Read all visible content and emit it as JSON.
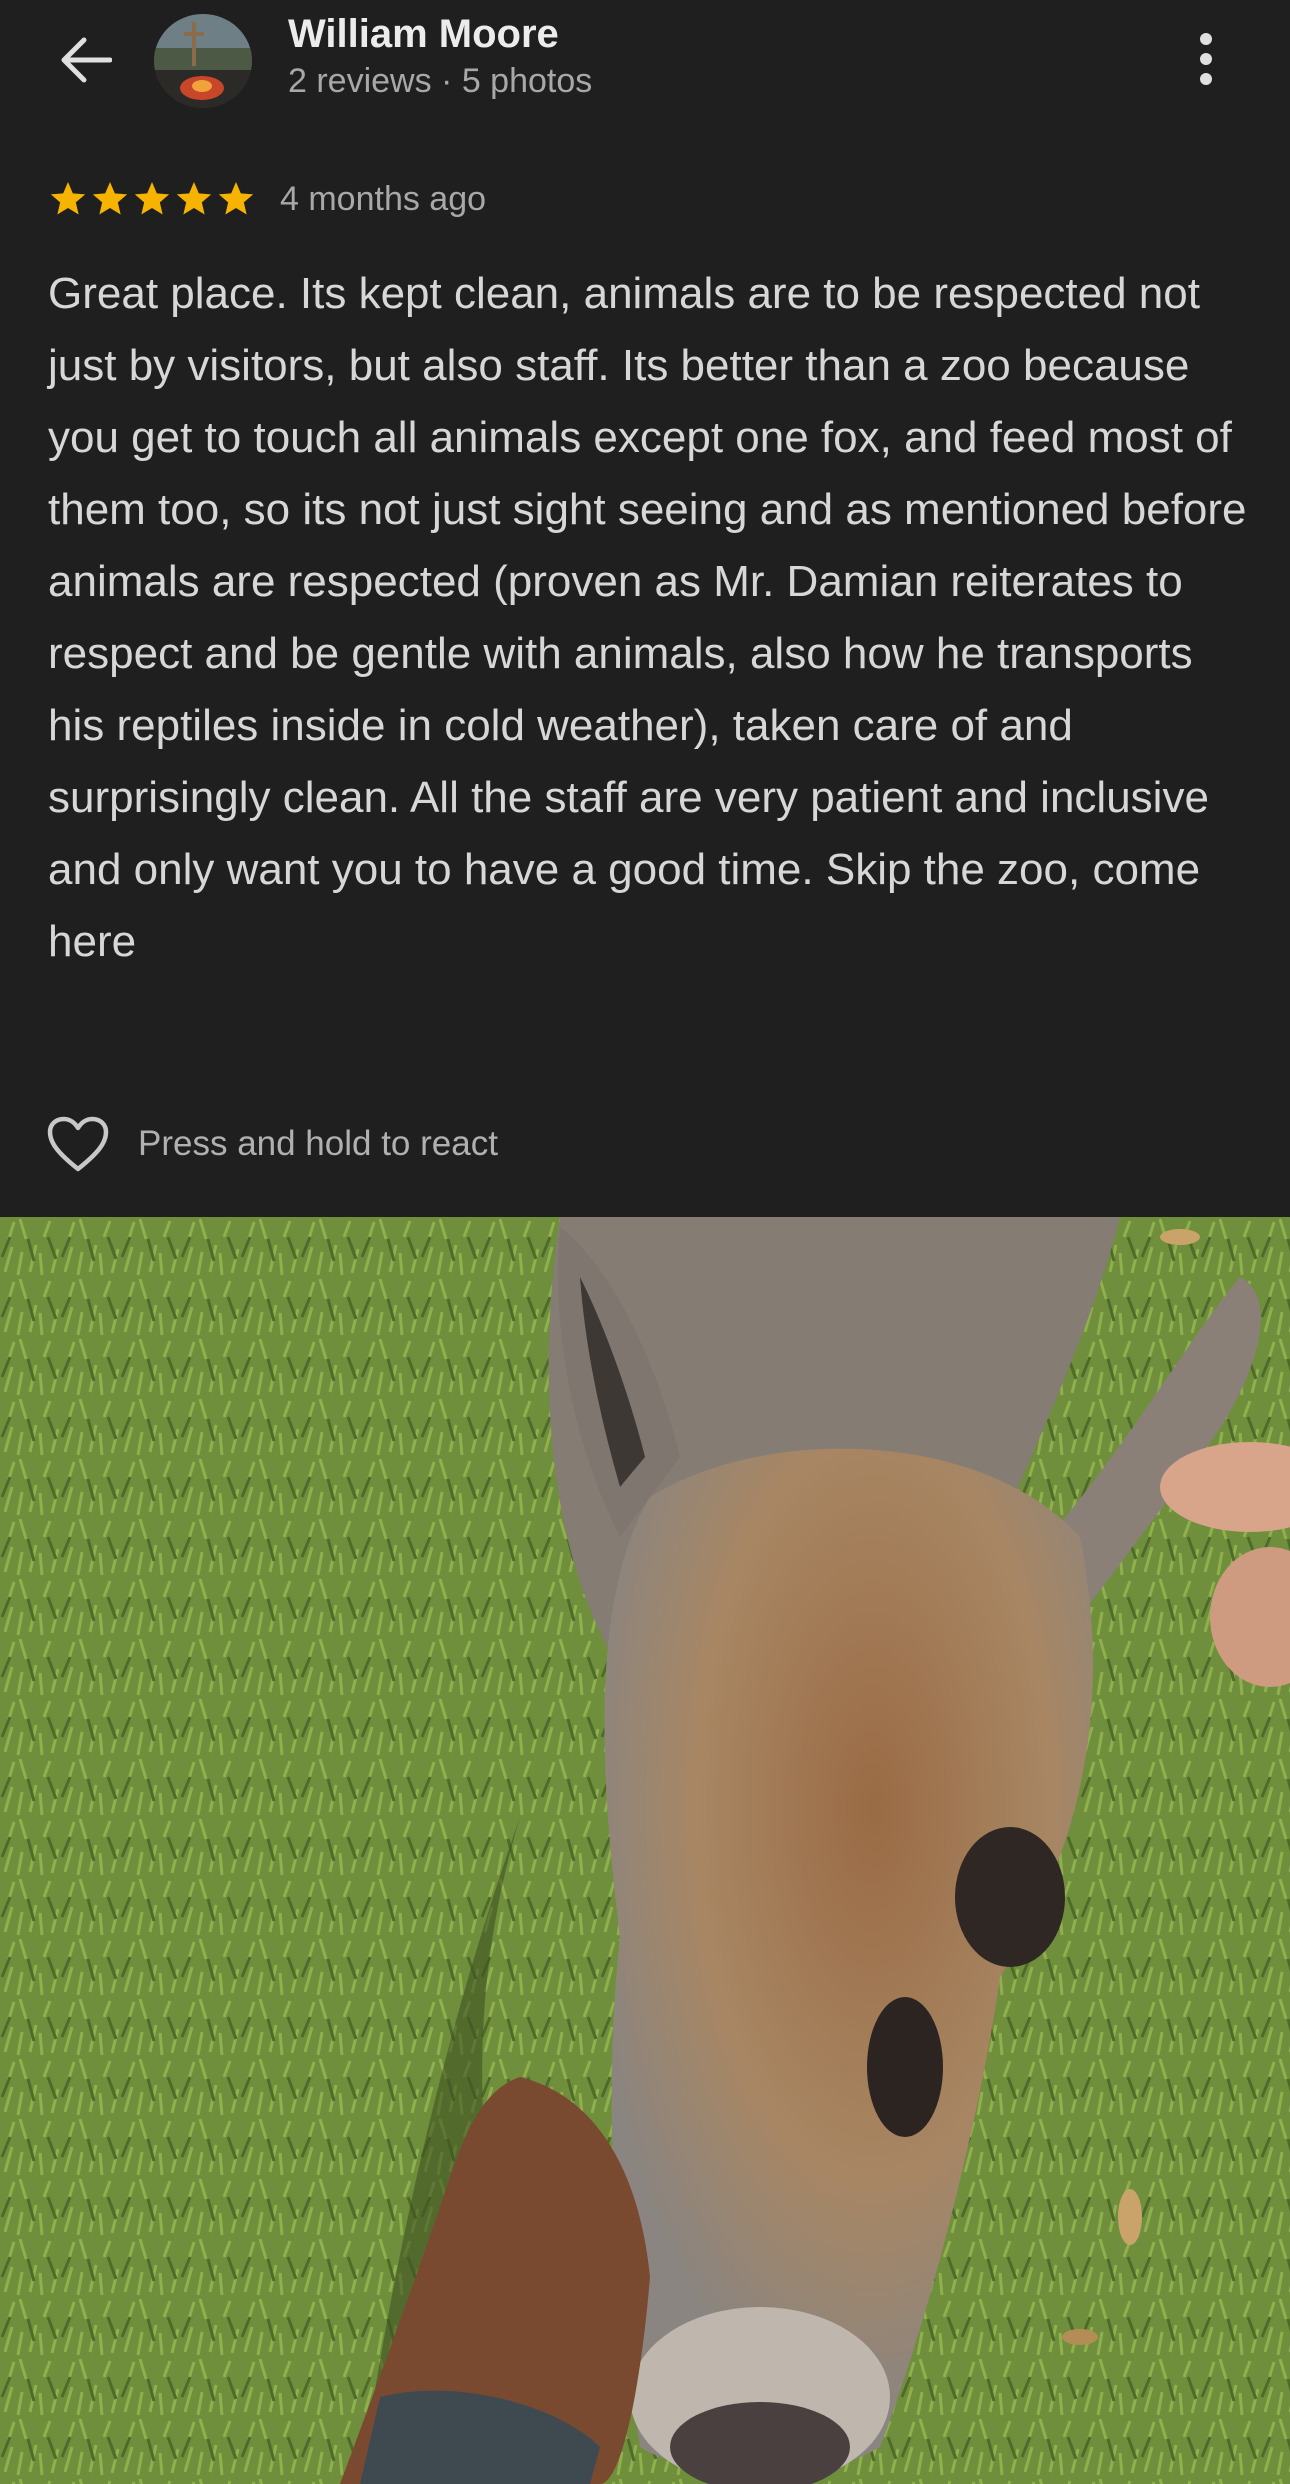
{
  "header": {
    "name": "William Moore",
    "meta": "2 reviews · 5 photos"
  },
  "review": {
    "rating": 5,
    "rating_max": 5,
    "time_ago": "4 months ago",
    "text": "Great place. Its kept clean, animals are to be respected not just by visitors, but also staff. Its better than a zoo because you get to touch all animals except one fox, and feed most of them too, so its not just sight seeing and as mentioned before animals are respected (proven as Mr. Damian reiterates to respect and be gentle with animals, also how he transports his reptiles inside in cold weather), taken care of and surprisingly clean. All the staff are very patient and inclusive and only want you to have a good time. Skip the zoo, come here"
  },
  "react": {
    "label": "Press and hold to react"
  },
  "icons": {
    "back": "arrow-left-icon",
    "more": "more-vertical-icon",
    "star": "star-icon",
    "heart": "heart-outline-icon"
  },
  "colors": {
    "background": "#1f1f1f",
    "star": "#f6b400",
    "text_primary": "#ececec",
    "text_secondary": "#a8a8a8"
  }
}
